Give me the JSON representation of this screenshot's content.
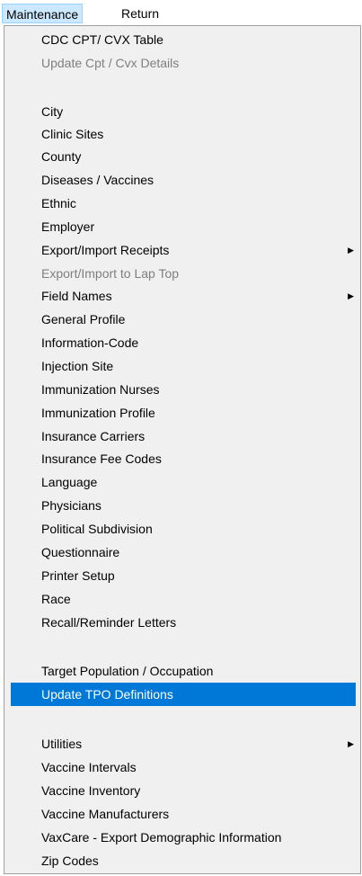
{
  "menubar": {
    "maintenance": "Maintenance",
    "return": "Return"
  },
  "menu": {
    "items": [
      {
        "label": "CDC CPT/ CVX Table"
      },
      {
        "label": "Update Cpt / Cvx Details",
        "disabled": true
      },
      {
        "label": "City"
      },
      {
        "label": "Clinic Sites"
      },
      {
        "label": "County"
      },
      {
        "label": "Diseases / Vaccines"
      },
      {
        "label": "Ethnic"
      },
      {
        "label": "Employer"
      },
      {
        "label": "Export/Import Receipts",
        "submenu": true
      },
      {
        "label": "Export/Import to Lap Top",
        "disabled": true
      },
      {
        "label": "Field Names",
        "submenu": true
      },
      {
        "label": "General Profile"
      },
      {
        "label": "Information-Code"
      },
      {
        "label": "Injection Site"
      },
      {
        "label": "Immunization Nurses"
      },
      {
        "label": "Immunization Profile"
      },
      {
        "label": "Insurance Carriers"
      },
      {
        "label": "Insurance Fee Codes"
      },
      {
        "label": "Language"
      },
      {
        "label": "Physicians"
      },
      {
        "label": "Political Subdivision"
      },
      {
        "label": "Questionnaire"
      },
      {
        "label": "Printer Setup"
      },
      {
        "label": "Race"
      },
      {
        "label": "Recall/Reminder Letters"
      },
      {
        "label": "Target Population / Occupation"
      },
      {
        "label": "Update TPO Definitions",
        "highlighted": true
      },
      {
        "label": "Utilities",
        "submenu": true
      },
      {
        "label": "Vaccine Intervals"
      },
      {
        "label": "Vaccine Inventory"
      },
      {
        "label": "Vaccine Manufacturers"
      },
      {
        "label": "VaxCare - Export Demographic Information"
      },
      {
        "label": "Zip Codes"
      }
    ],
    "submenu_arrow_icon": "chevron-right-icon"
  },
  "colors": {
    "highlight": "#0078d7",
    "disabled_text": "#7f7f7f",
    "menubar_active": "#cce8ff"
  }
}
